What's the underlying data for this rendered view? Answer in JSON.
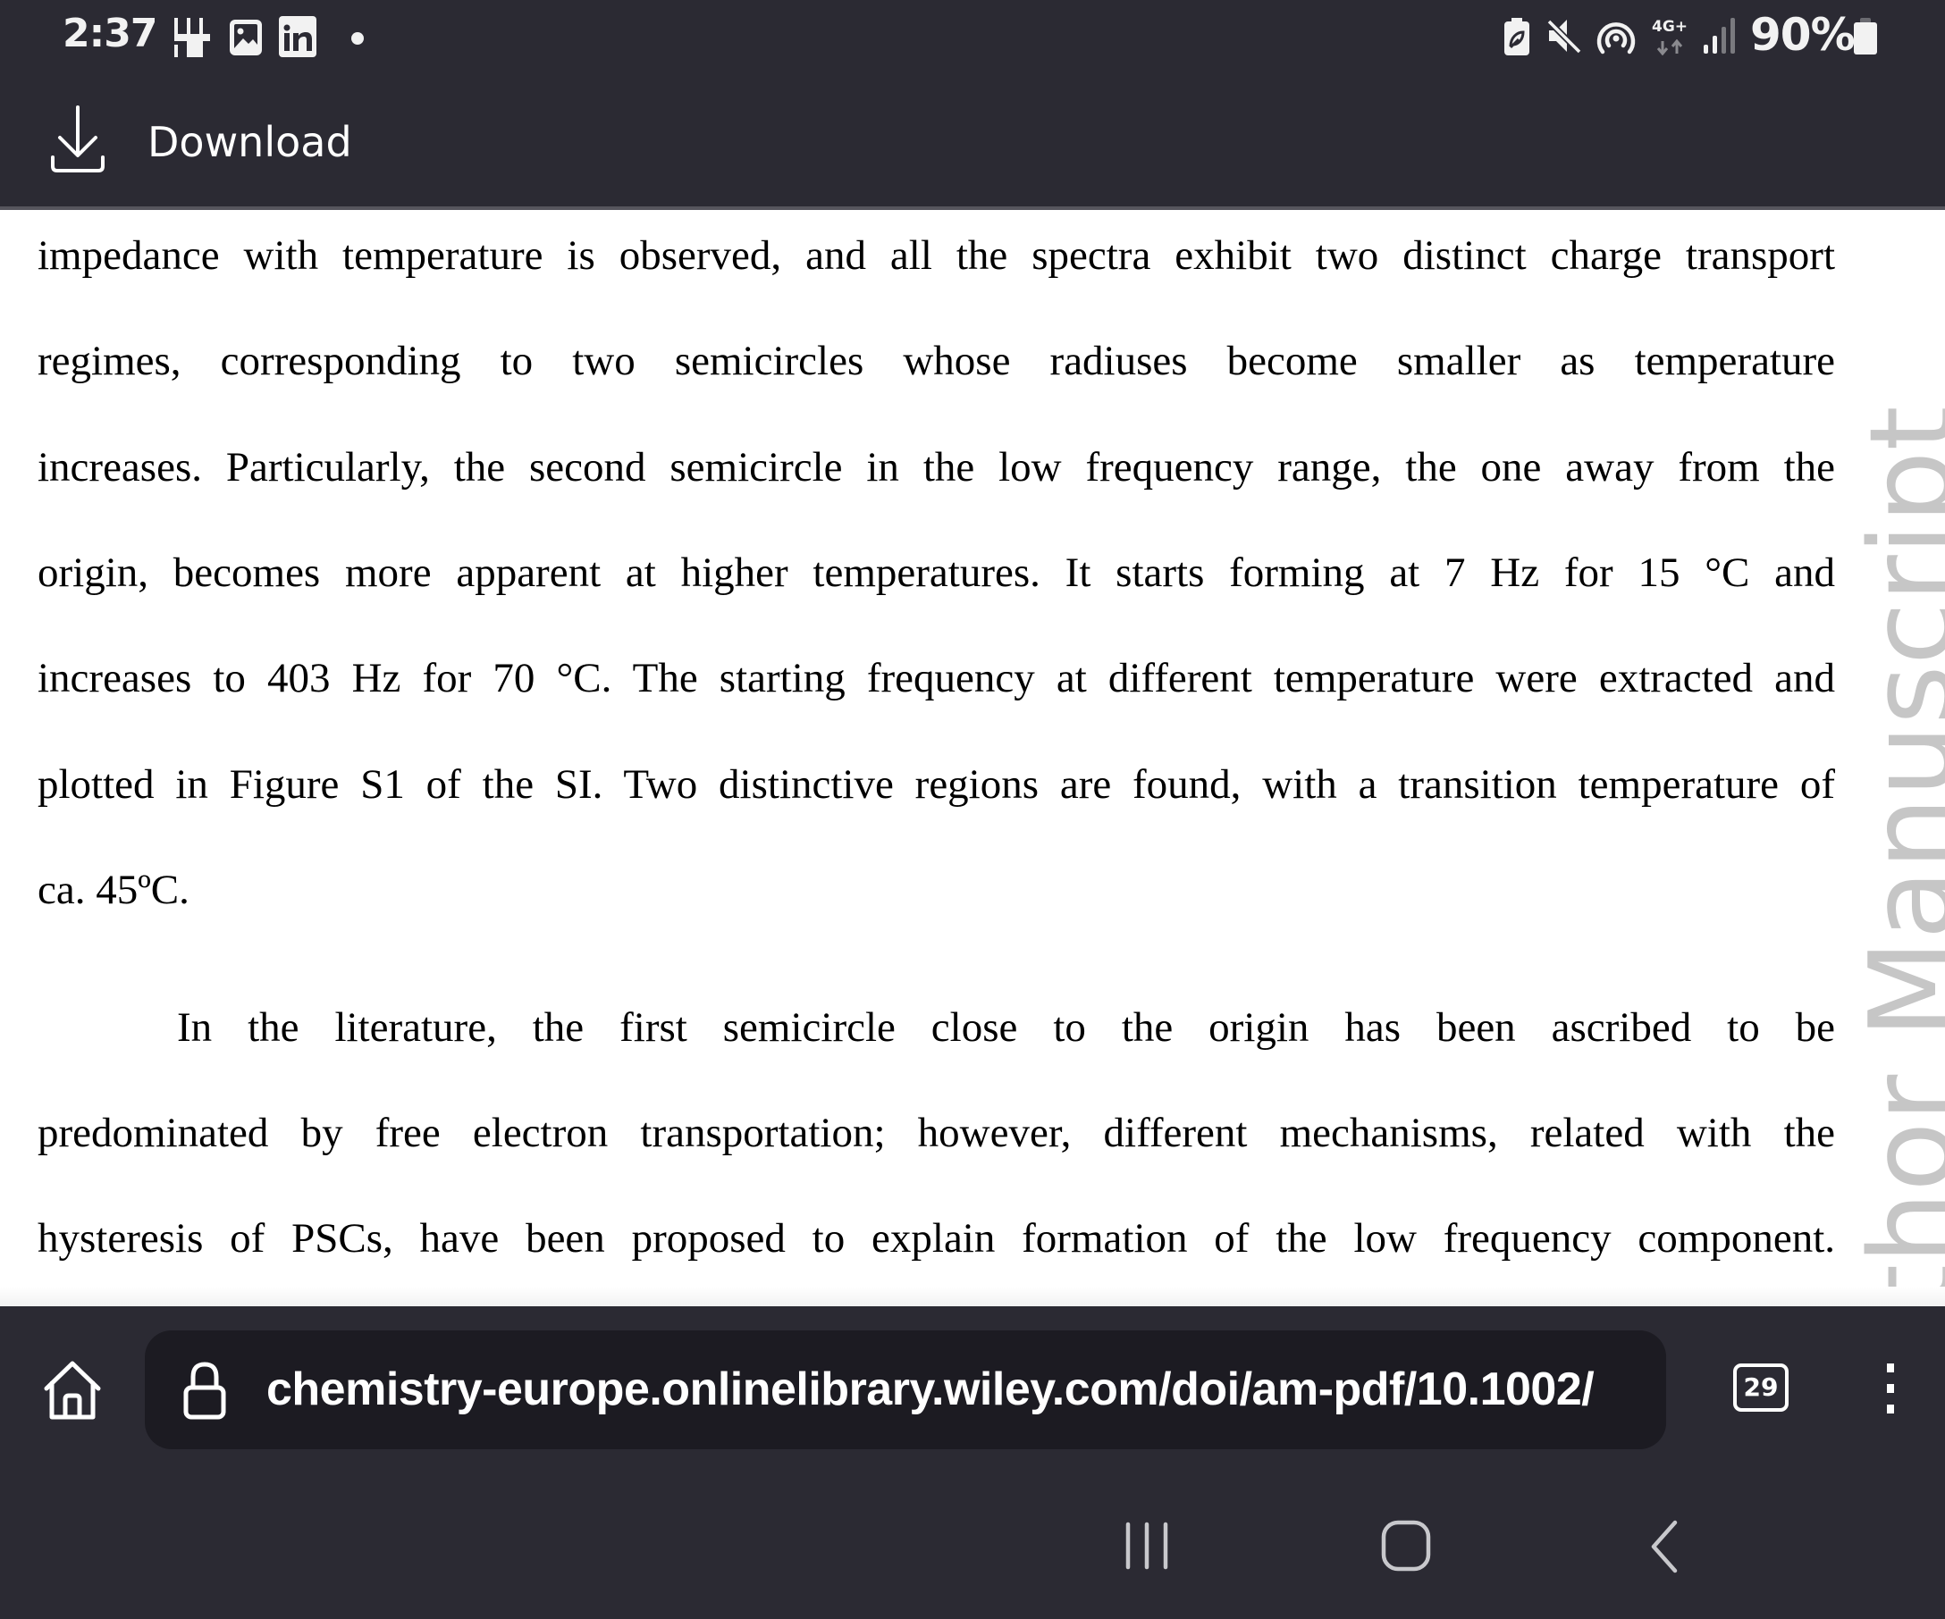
{
  "status_bar": {
    "time": "2:37",
    "notification_icons": [
      "grid-app-icon",
      "gallery-icon",
      "linkedin-icon",
      "more-notifications-dot"
    ],
    "system_icons": [
      "battery-saver-icon",
      "mute-icon",
      "hotspot-icon",
      "network-4g-icon",
      "signal-icon",
      "battery-icon"
    ],
    "network_type": "4G+",
    "battery_percent": "90%"
  },
  "header": {
    "download_label": "Download"
  },
  "document": {
    "lines": [
      "impedance with temperature is observed, and all the spectra exhibit two distinct charge transport",
      "regimes, corresponding to two semicircles whose radiuses become smaller as temperature",
      "increases. Particularly, the second semicircle in the low frequency range, the one away from the",
      "origin, becomes more apparent at higher temperatures. It starts forming at 7 Hz for 15 °C and",
      "increases to 403 Hz for 70 °C. The starting frequency at different temperature were extracted and",
      "plotted in Figure S1 of the SI. Two distinctive regions are found, with a transition temperature of",
      "ca. 45ºC.",
      "In the literature, the first semicircle close to the origin has been ascribed to be",
      "predominated by free electron transportation; however, different mechanisms, related with the",
      "hysteresis of PSCs, have been proposed to explain formation of the low frequency component."
    ],
    "watermark": "thor Manuscript"
  },
  "browser_toolbar": {
    "url": "chemistry-europe.onlinelibrary.wiley.com/doi/am-pdf/10.1002/",
    "tab_count": "29"
  },
  "colors": {
    "chrome_bg": "#2b2a33",
    "url_pill_bg": "#1c1b22",
    "page_bg": "#ffffff",
    "watermark": "#c6c6c6"
  }
}
